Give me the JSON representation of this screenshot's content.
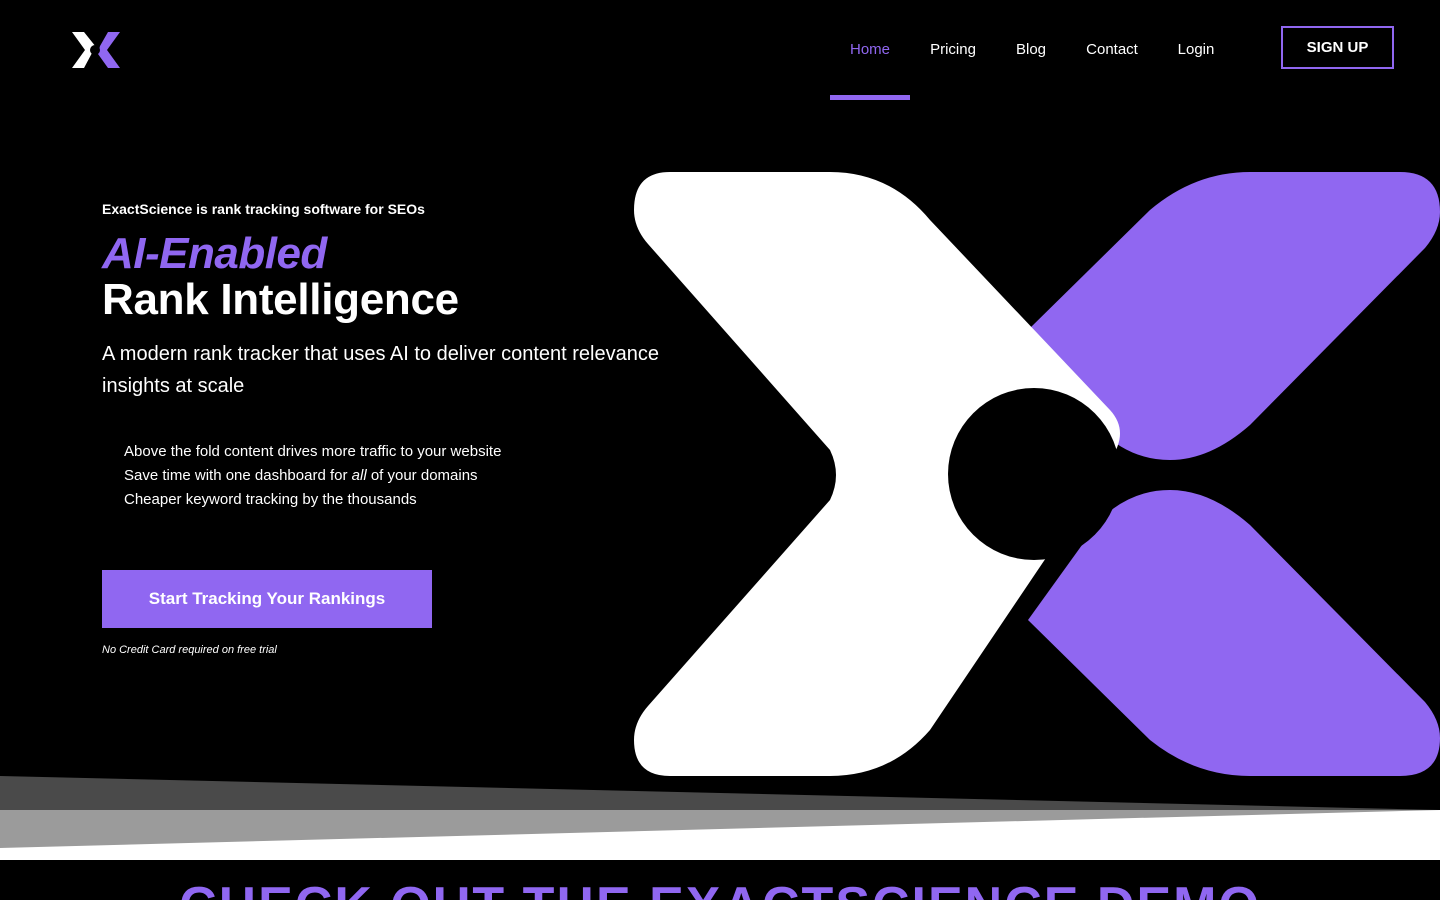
{
  "brand": {
    "accent_color": "#9067f1",
    "logo_icon": "x-logo-icon"
  },
  "nav": {
    "items": [
      {
        "label": "Home",
        "active": true
      },
      {
        "label": "Pricing",
        "active": false
      },
      {
        "label": "Blog",
        "active": false
      },
      {
        "label": "Contact",
        "active": false
      },
      {
        "label": "Login",
        "active": false
      }
    ],
    "signup_label": "SIGN UP"
  },
  "hero": {
    "tagline": "ExactScience is rank tracking software for SEOs",
    "headline_accent": "AI-Enabled",
    "headline_main": "Rank Intelligence",
    "subheadline": "A modern rank tracker that uses AI to deliver content relevance insights at scale",
    "benefits": [
      {
        "text": "Above the fold content drives more traffic to your website"
      },
      {
        "before": "Save time with one dashboard for ",
        "emphasis": "all",
        "after": " of your domains"
      },
      {
        "text": "Cheaper keyword tracking by the thousands"
      }
    ],
    "cta_label": "Start Tracking Your Rankings",
    "cta_note": "No Credit Card required on free trial"
  },
  "demo": {
    "heading": "CHECK OUT THE EXACTSCIENCE DEMO"
  }
}
